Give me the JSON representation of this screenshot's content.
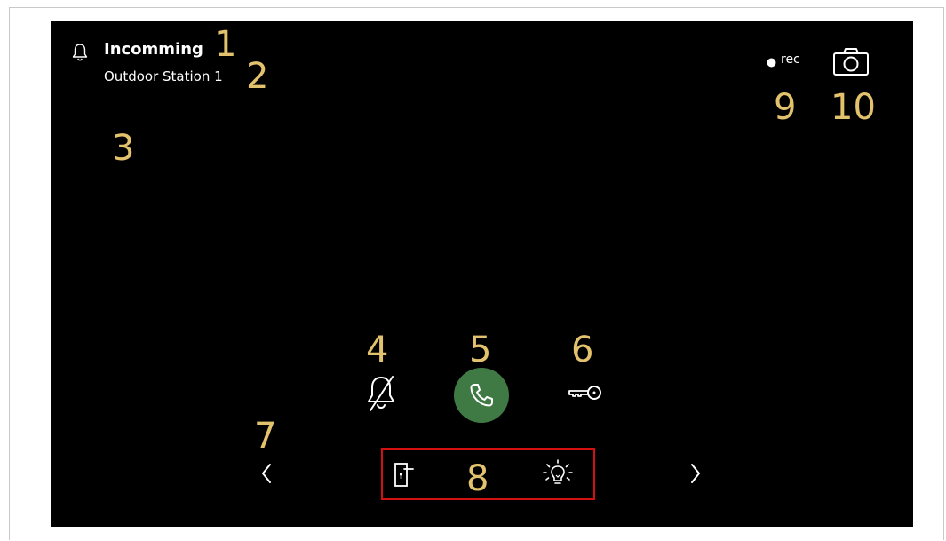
{
  "header": {
    "title": "Incomming",
    "subtitle": "Outdoor Station 1"
  },
  "recording": {
    "label": "rec"
  },
  "callouts": [
    "1",
    "2",
    "3",
    "4",
    "5",
    "6",
    "7",
    "8",
    "9",
    "10"
  ],
  "icons": {
    "bell": "bell-icon",
    "rec_dot": "record-dot-icon",
    "camera": "camera-icon",
    "mute": "bell-muted-icon",
    "answer": "phone-icon",
    "door_key": "key-icon",
    "door_handle": "door-handle-icon",
    "light": "light-bulb-icon",
    "prev": "chevron-left-icon",
    "next": "chevron-right-icon"
  },
  "colors": {
    "background": "#000000",
    "answer_button": "#3f7a45",
    "callout": "#e3c26d",
    "highlight_border": "#d41010"
  }
}
